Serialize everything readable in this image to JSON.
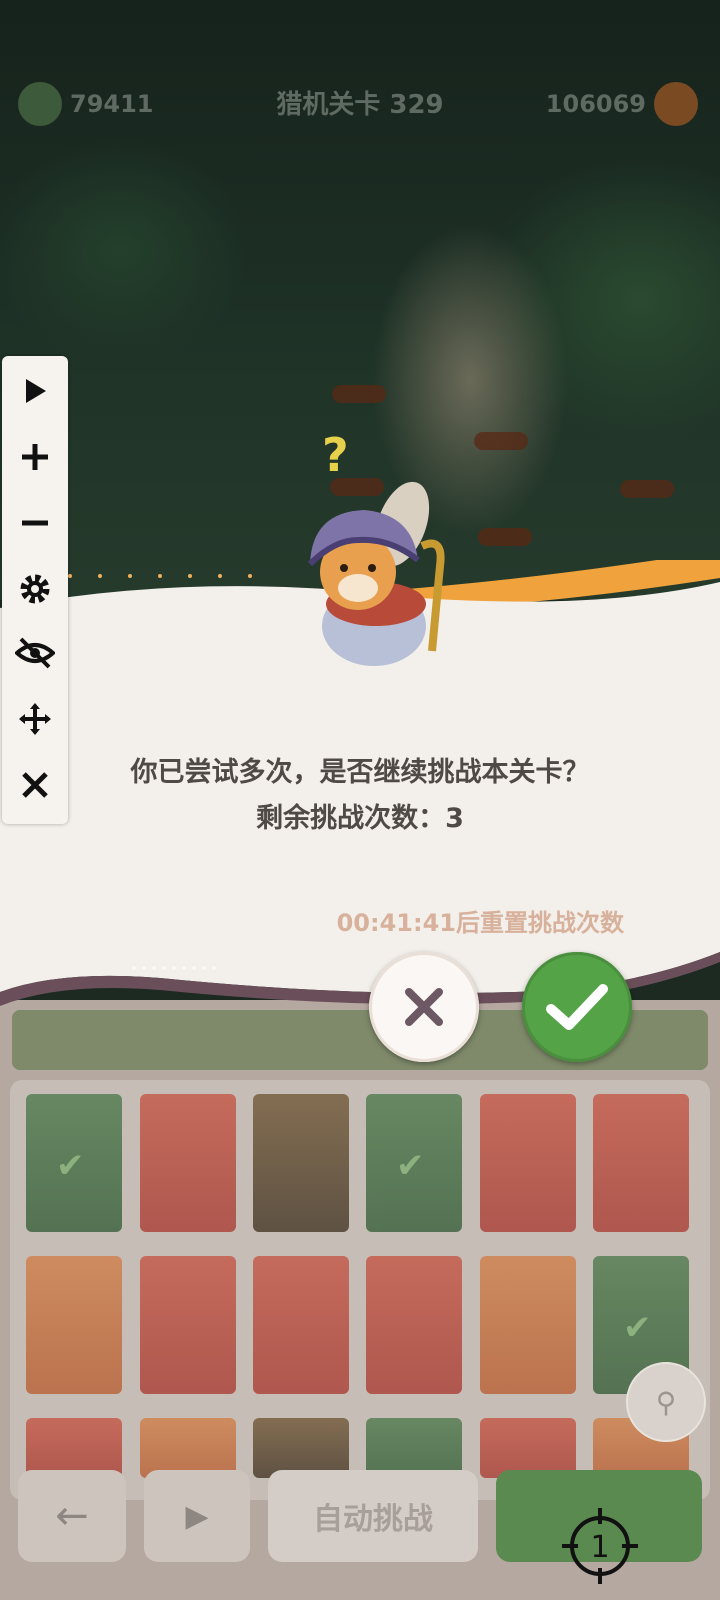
{
  "top_bar": {
    "left_value": "79411",
    "stage_title": "猎机关卡 329",
    "right_value": "106069"
  },
  "toolbar": {
    "icons": [
      "play-icon",
      "plus-icon",
      "minus-icon",
      "gear-icon",
      "eye-off-icon",
      "move-icon",
      "close-icon"
    ]
  },
  "dialog": {
    "message_line1": "你已尝试多次，是否继续挑战本关卡？",
    "message_line2": "剩余挑战次数：3",
    "reset_text": "00:41:41后重置挑战次数",
    "cancel_icon": "x-icon",
    "confirm_icon": "check-icon"
  },
  "bottom_bar": {
    "auto_label": "自动挑战",
    "crosshair_number": "1"
  },
  "colors": {
    "confirm_green": "#55a347",
    "dialog_bg": "#f3efea",
    "accent_orange": "#f0a23c",
    "reset_text": "#d7b19b"
  }
}
